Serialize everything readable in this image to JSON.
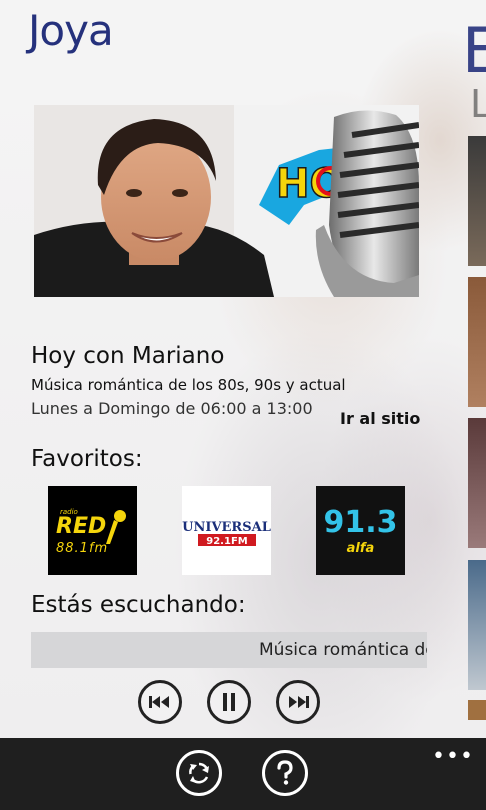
{
  "app": {
    "title": "Joya",
    "next_section_title": "E",
    "next_section_subtitle": "L"
  },
  "hero": {
    "logo_text": "HOY",
    "image_description_icon": "host-photo-with-microphone"
  },
  "show": {
    "name": "Hoy con Mariano",
    "description": "Música romántica de los 80s, 90s y actual",
    "schedule": "Lunes a Domingo de 06:00 a 13:00",
    "website_link": "Ir al sitio"
  },
  "favorites": {
    "title": "Favoritos:",
    "items": [
      {
        "brand": "RED",
        "small": "radio",
        "freq": "88.1fm",
        "bg": "#000000"
      },
      {
        "brand": "UNIVERSAL",
        "freq": "92.1FM",
        "bg": "#ffffff"
      },
      {
        "brand": "91.3",
        "sub": "alfa",
        "bg": "#111111"
      }
    ]
  },
  "now_playing": {
    "title": "Estás escuchando:",
    "ticker": "Música romántica de"
  },
  "player": {
    "prev_icon": "skip-back-icon",
    "pause_icon": "pause-icon",
    "next_icon": "skip-forward-icon"
  },
  "appbar": {
    "refresh_icon": "refresh-icon",
    "help_icon": "question-icon",
    "more_label": "•••"
  },
  "colors": {
    "title": "#25317c",
    "appbar": "#1f1f1f",
    "ticker_bg": "#d6d6d8",
    "accent_yellow": "#f5d50c",
    "accent_red": "#e2111b"
  }
}
